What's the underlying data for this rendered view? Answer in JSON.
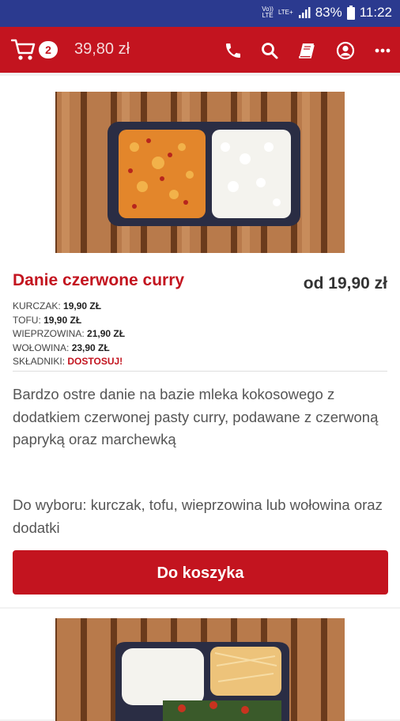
{
  "status_bar": {
    "volte": "Vo))\nLTE",
    "lte": "LTE+",
    "battery": "83%",
    "time": "11:22"
  },
  "header": {
    "cart_count": "2",
    "cart_total": "39,80 zł",
    "icons": [
      "phone-icon",
      "search-icon",
      "menu-book-icon",
      "account-icon",
      "more-icon"
    ]
  },
  "product": {
    "title": "Danie czerwone curry",
    "price_from": "od 19,90 zł",
    "variants": [
      {
        "name": "KURCZAK:",
        "price": "19,90 ZŁ"
      },
      {
        "name": "TOFU:",
        "price": "19,90 ZŁ"
      },
      {
        "name": "WIEPRZOWINA:",
        "price": "21,90 ZŁ"
      },
      {
        "name": "WOŁOWINA:",
        "price": "23,90 ZŁ"
      }
    ],
    "ingredients_label": "SKŁADNIKI:",
    "ingredients_action": "DOSTOSUJ!",
    "description": "Bardzo ostre danie na bazie mleka kokosowego z dodatkiem czerwonej pasty curry, podawane z czerwoną papryką oraz marchewką",
    "choice": "Do wyboru: kurczak, tofu, wieprzowina lub wołowina oraz dodatki",
    "add_to_cart": "Do koszyka"
  },
  "colors": {
    "brand_red": "#c3141f",
    "status_bar": "#2b3a8f"
  }
}
